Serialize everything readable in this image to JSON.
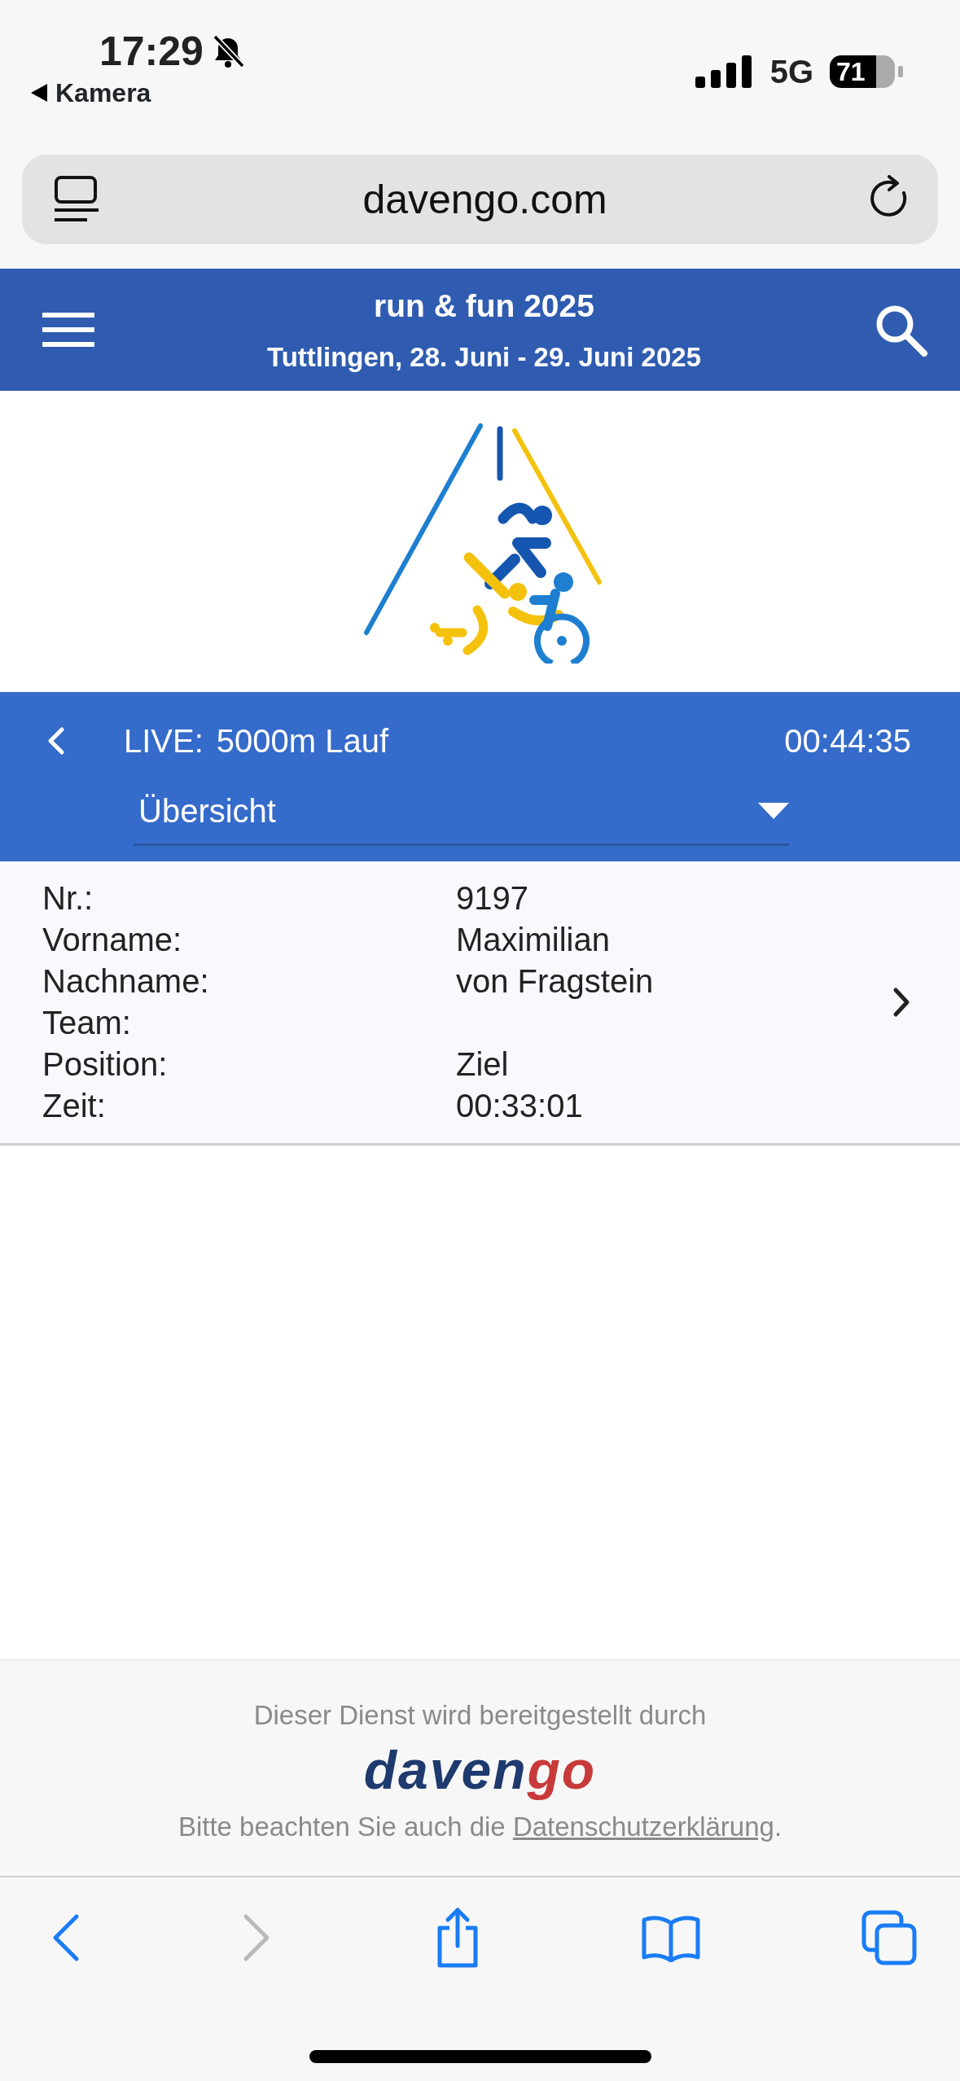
{
  "status_bar": {
    "time": "17:29",
    "back_label": "Kamera",
    "network": "5G",
    "battery": "71"
  },
  "address_bar": {
    "url": "davengo.com"
  },
  "header": {
    "title": "run & fun 2025",
    "subtitle": "Tuttlingen, 28. Juni - 29. Juni 2025"
  },
  "live_bar": {
    "label": "LIVE:",
    "event": "5000m Lauf",
    "clock": "00:44:35",
    "view_select": {
      "value": "Übersicht"
    }
  },
  "participant": {
    "fields": [
      {
        "label": "Nr.:",
        "value": "9197"
      },
      {
        "label": "Vorname:",
        "value": "Maximilian"
      },
      {
        "label": "Nachname:",
        "value": "von Fragstein"
      },
      {
        "label": "Team:"
      },
      {
        "label": "Position:",
        "value": "Ziel"
      },
      {
        "label": "Zeit:",
        "value": "00:33:01"
      }
    ]
  },
  "footer": {
    "provided_by": "Dieser Dienst wird bereitgestellt durch",
    "logo_parts": [
      {
        "text": "daven",
        "color": "#1e3a6e"
      },
      {
        "text": "go",
        "color": "#c83a3a"
      }
    ],
    "notice": "Bitte beachten Sie auch die",
    "privacy_link": "Datenschutzerklärung",
    "notice_end": "."
  },
  "toolbar": [
    {
      "kind": "back",
      "disabled": false
    },
    {
      "kind": "forward",
      "disabled": true
    },
    {
      "kind": "share",
      "disabled": false
    },
    {
      "kind": "bookmarks",
      "disabled": false
    },
    {
      "kind": "tabs",
      "disabled": false
    }
  ]
}
